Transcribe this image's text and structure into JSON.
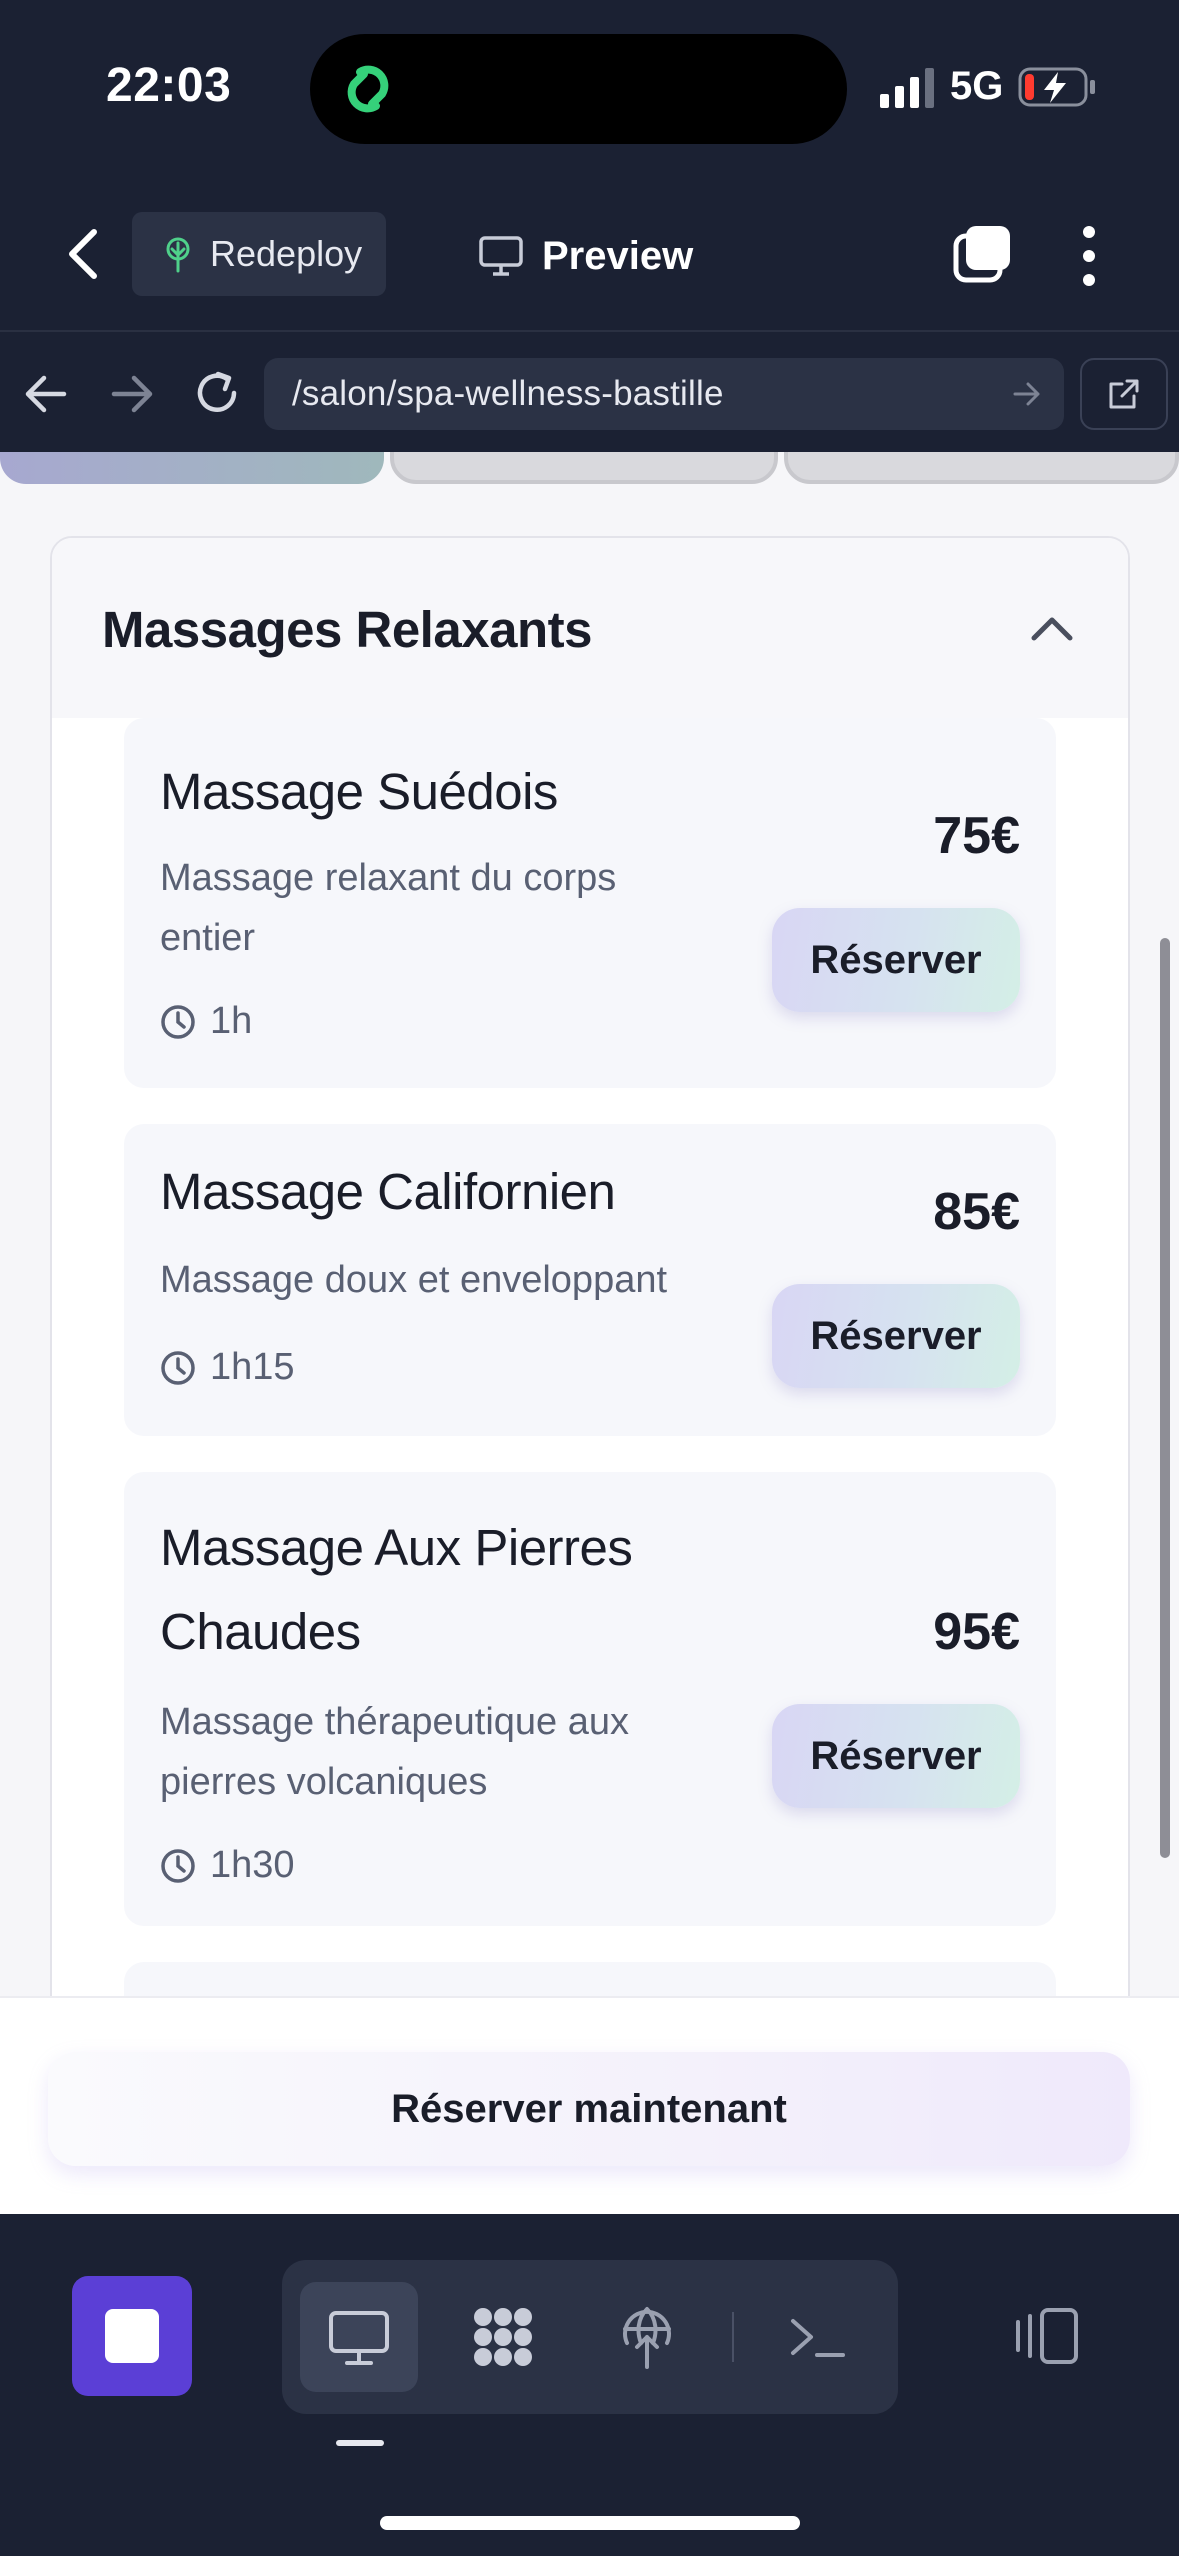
{
  "status_bar": {
    "time": "22:03",
    "network": "5G",
    "battery_level_fraction": 0.15
  },
  "header": {
    "redeploy_label": "Redeploy",
    "preview_label": "Preview"
  },
  "browser": {
    "url": "/salon/spa-wellness-bastille"
  },
  "category": {
    "title": "Massages Relaxants",
    "services": [
      {
        "name": "Massage Suédois",
        "description": "Massage relaxant du corps entier",
        "duration": "1h",
        "price": "75€",
        "button": "Réserver"
      },
      {
        "name": "Massage Californien",
        "description": "Massage doux et enveloppant",
        "duration": "1h15",
        "price": "85€",
        "button": "Réserver"
      },
      {
        "name": "Massage Aux Pierres Chaudes",
        "description": "Massage thérapeutique aux pierres volcaniques",
        "duration": "1h30",
        "price": "95€",
        "button": "Réserver"
      }
    ]
  },
  "footer": {
    "book_now_label": "Réserver maintenant"
  },
  "icons": {
    "app": "link-icon",
    "back": "chevron-left-icon",
    "redeploy": "deploy-tree-icon",
    "preview": "monitor-icon",
    "tabs": "tabs-icon",
    "menu": "more-vertical-icon",
    "reload": "reload-icon",
    "external": "external-link-icon",
    "clock": "clock-icon",
    "stop": "stop-icon",
    "console": "terminal-icon",
    "workflows": "grid-dots-icon",
    "deploy": "globe-deploy-icon",
    "panel": "panel-toggle-icon"
  },
  "colors": {
    "app_bg": "#1b2133",
    "accent_purple": "#5b3fd6",
    "link_green": "#35d17a"
  }
}
